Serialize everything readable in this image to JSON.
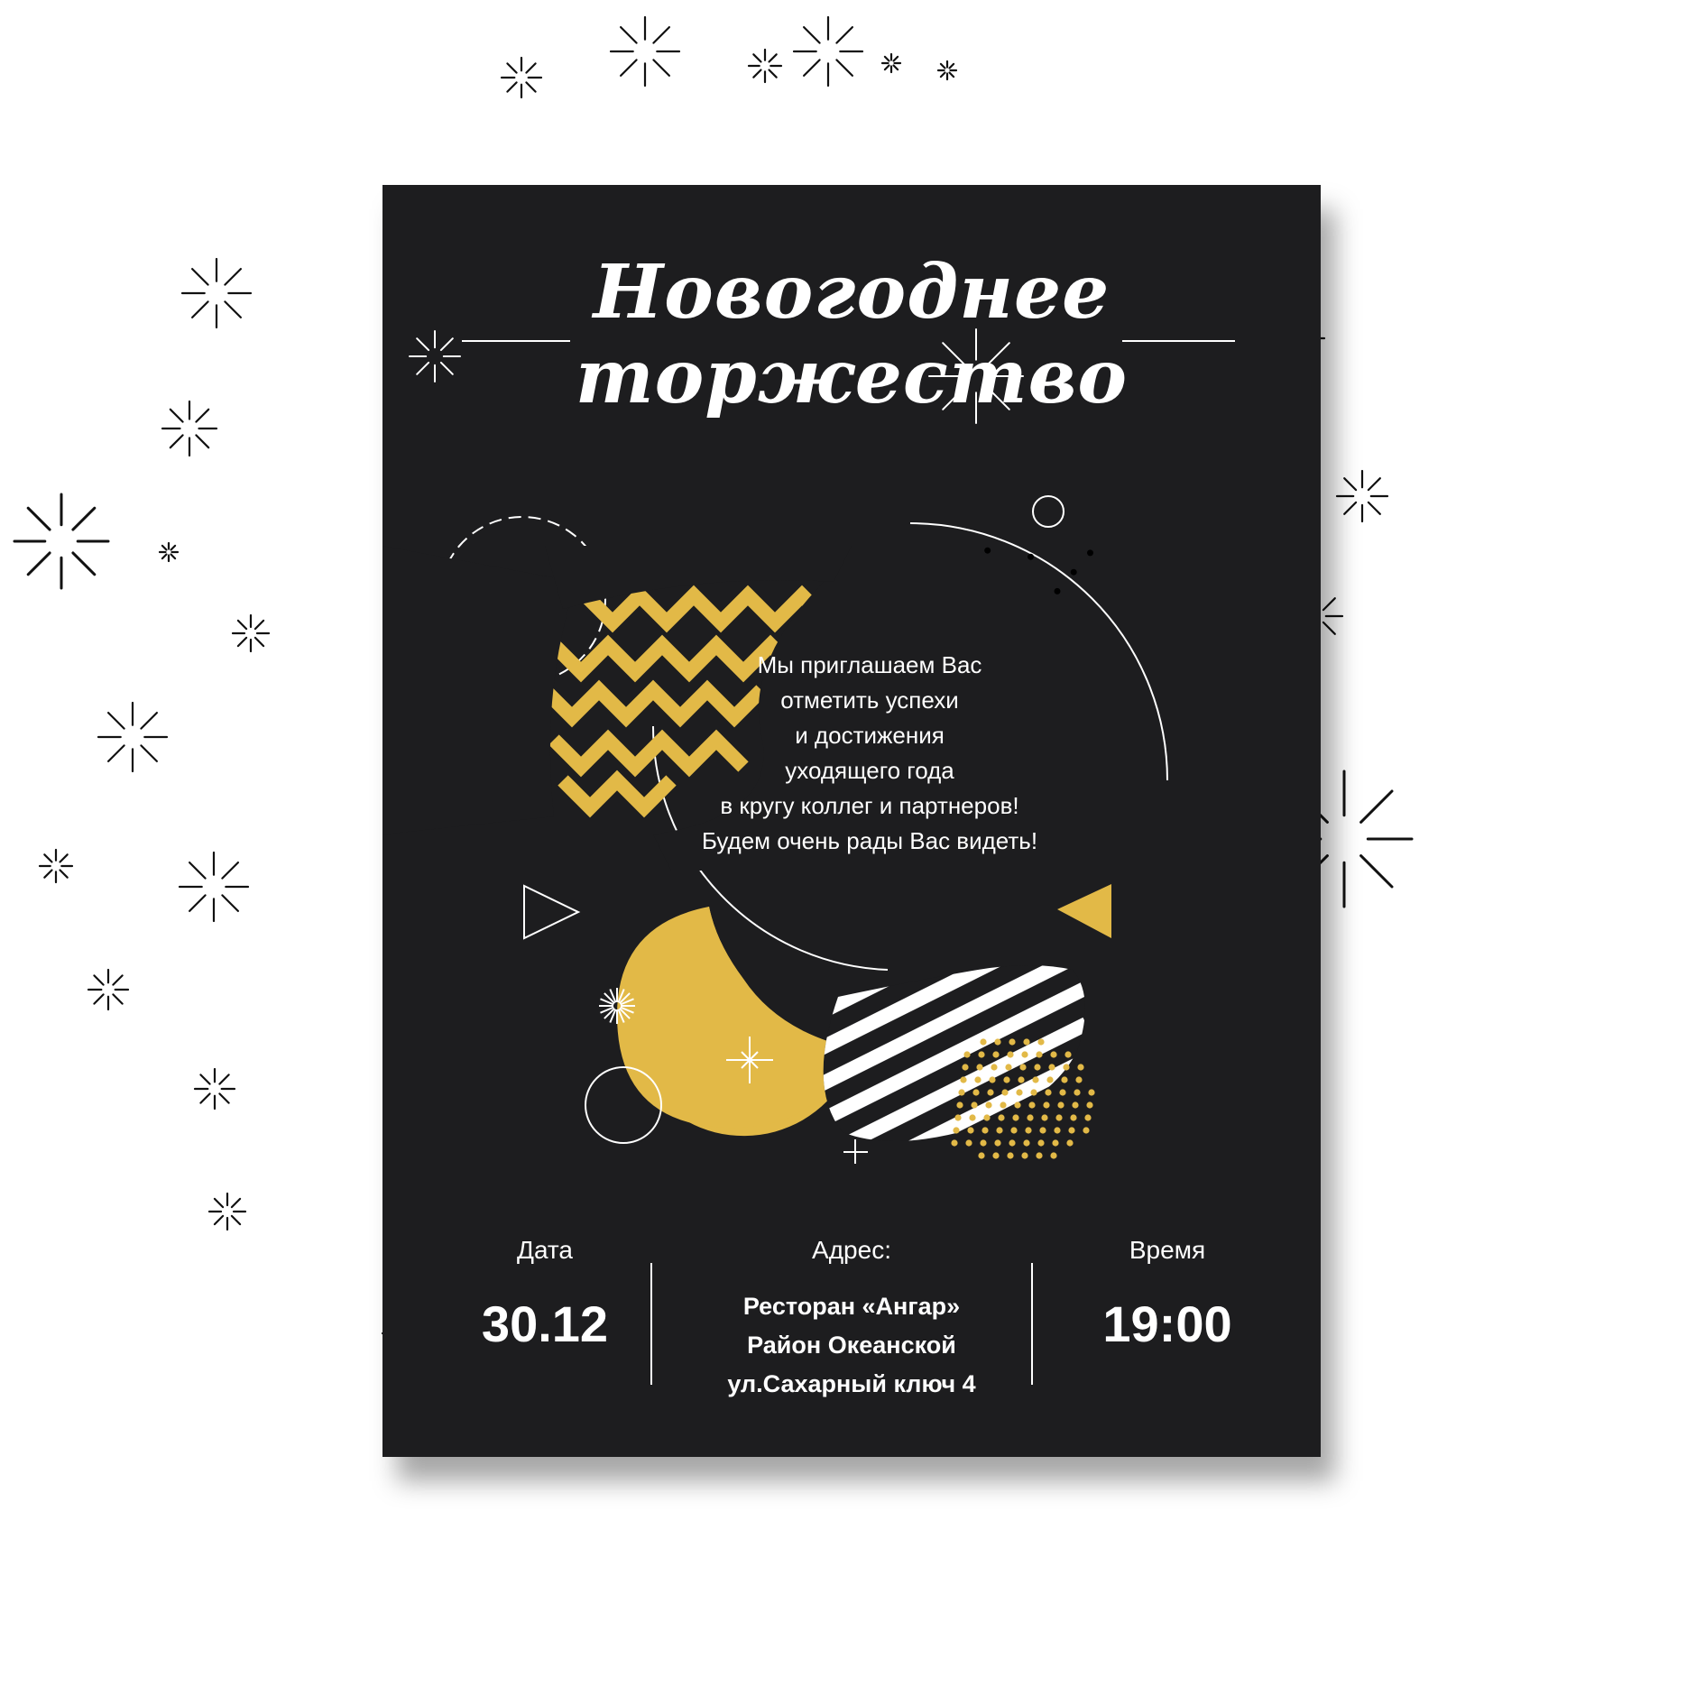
{
  "invitation": {
    "title_line_1": "Новогоднее",
    "title_line_2": "торжество",
    "message_lines": [
      "Мы приглашаем Вас",
      "отметить успехи",
      "и достижения",
      "уходящего года",
      "в кругу коллег и партнеров!",
      "Будем очень рады Вас видеть!"
    ],
    "date": {
      "label": "Дата",
      "value": "30.12"
    },
    "address": {
      "label": "Адрес:",
      "lines": [
        "Ресторан «Ангар»",
        "Район Океанской",
        "ул.Сахарный ключ 4"
      ]
    },
    "time": {
      "label": "Время",
      "value": "19:00"
    }
  },
  "colors": {
    "card_background": "#1d1d1f",
    "accent_gold": "#e2b947",
    "text": "#ffffff",
    "page_background": "#ffffff",
    "sparkle_stroke": "#111111"
  },
  "decor": {
    "background_motif": "sparkle-icon",
    "card_motifs": [
      "zigzag-ribbon",
      "gold-half-circle",
      "striped-wave",
      "dot-grid",
      "outline-triangle",
      "gold-triangle",
      "dashed-circle",
      "thin-arc"
    ]
  }
}
